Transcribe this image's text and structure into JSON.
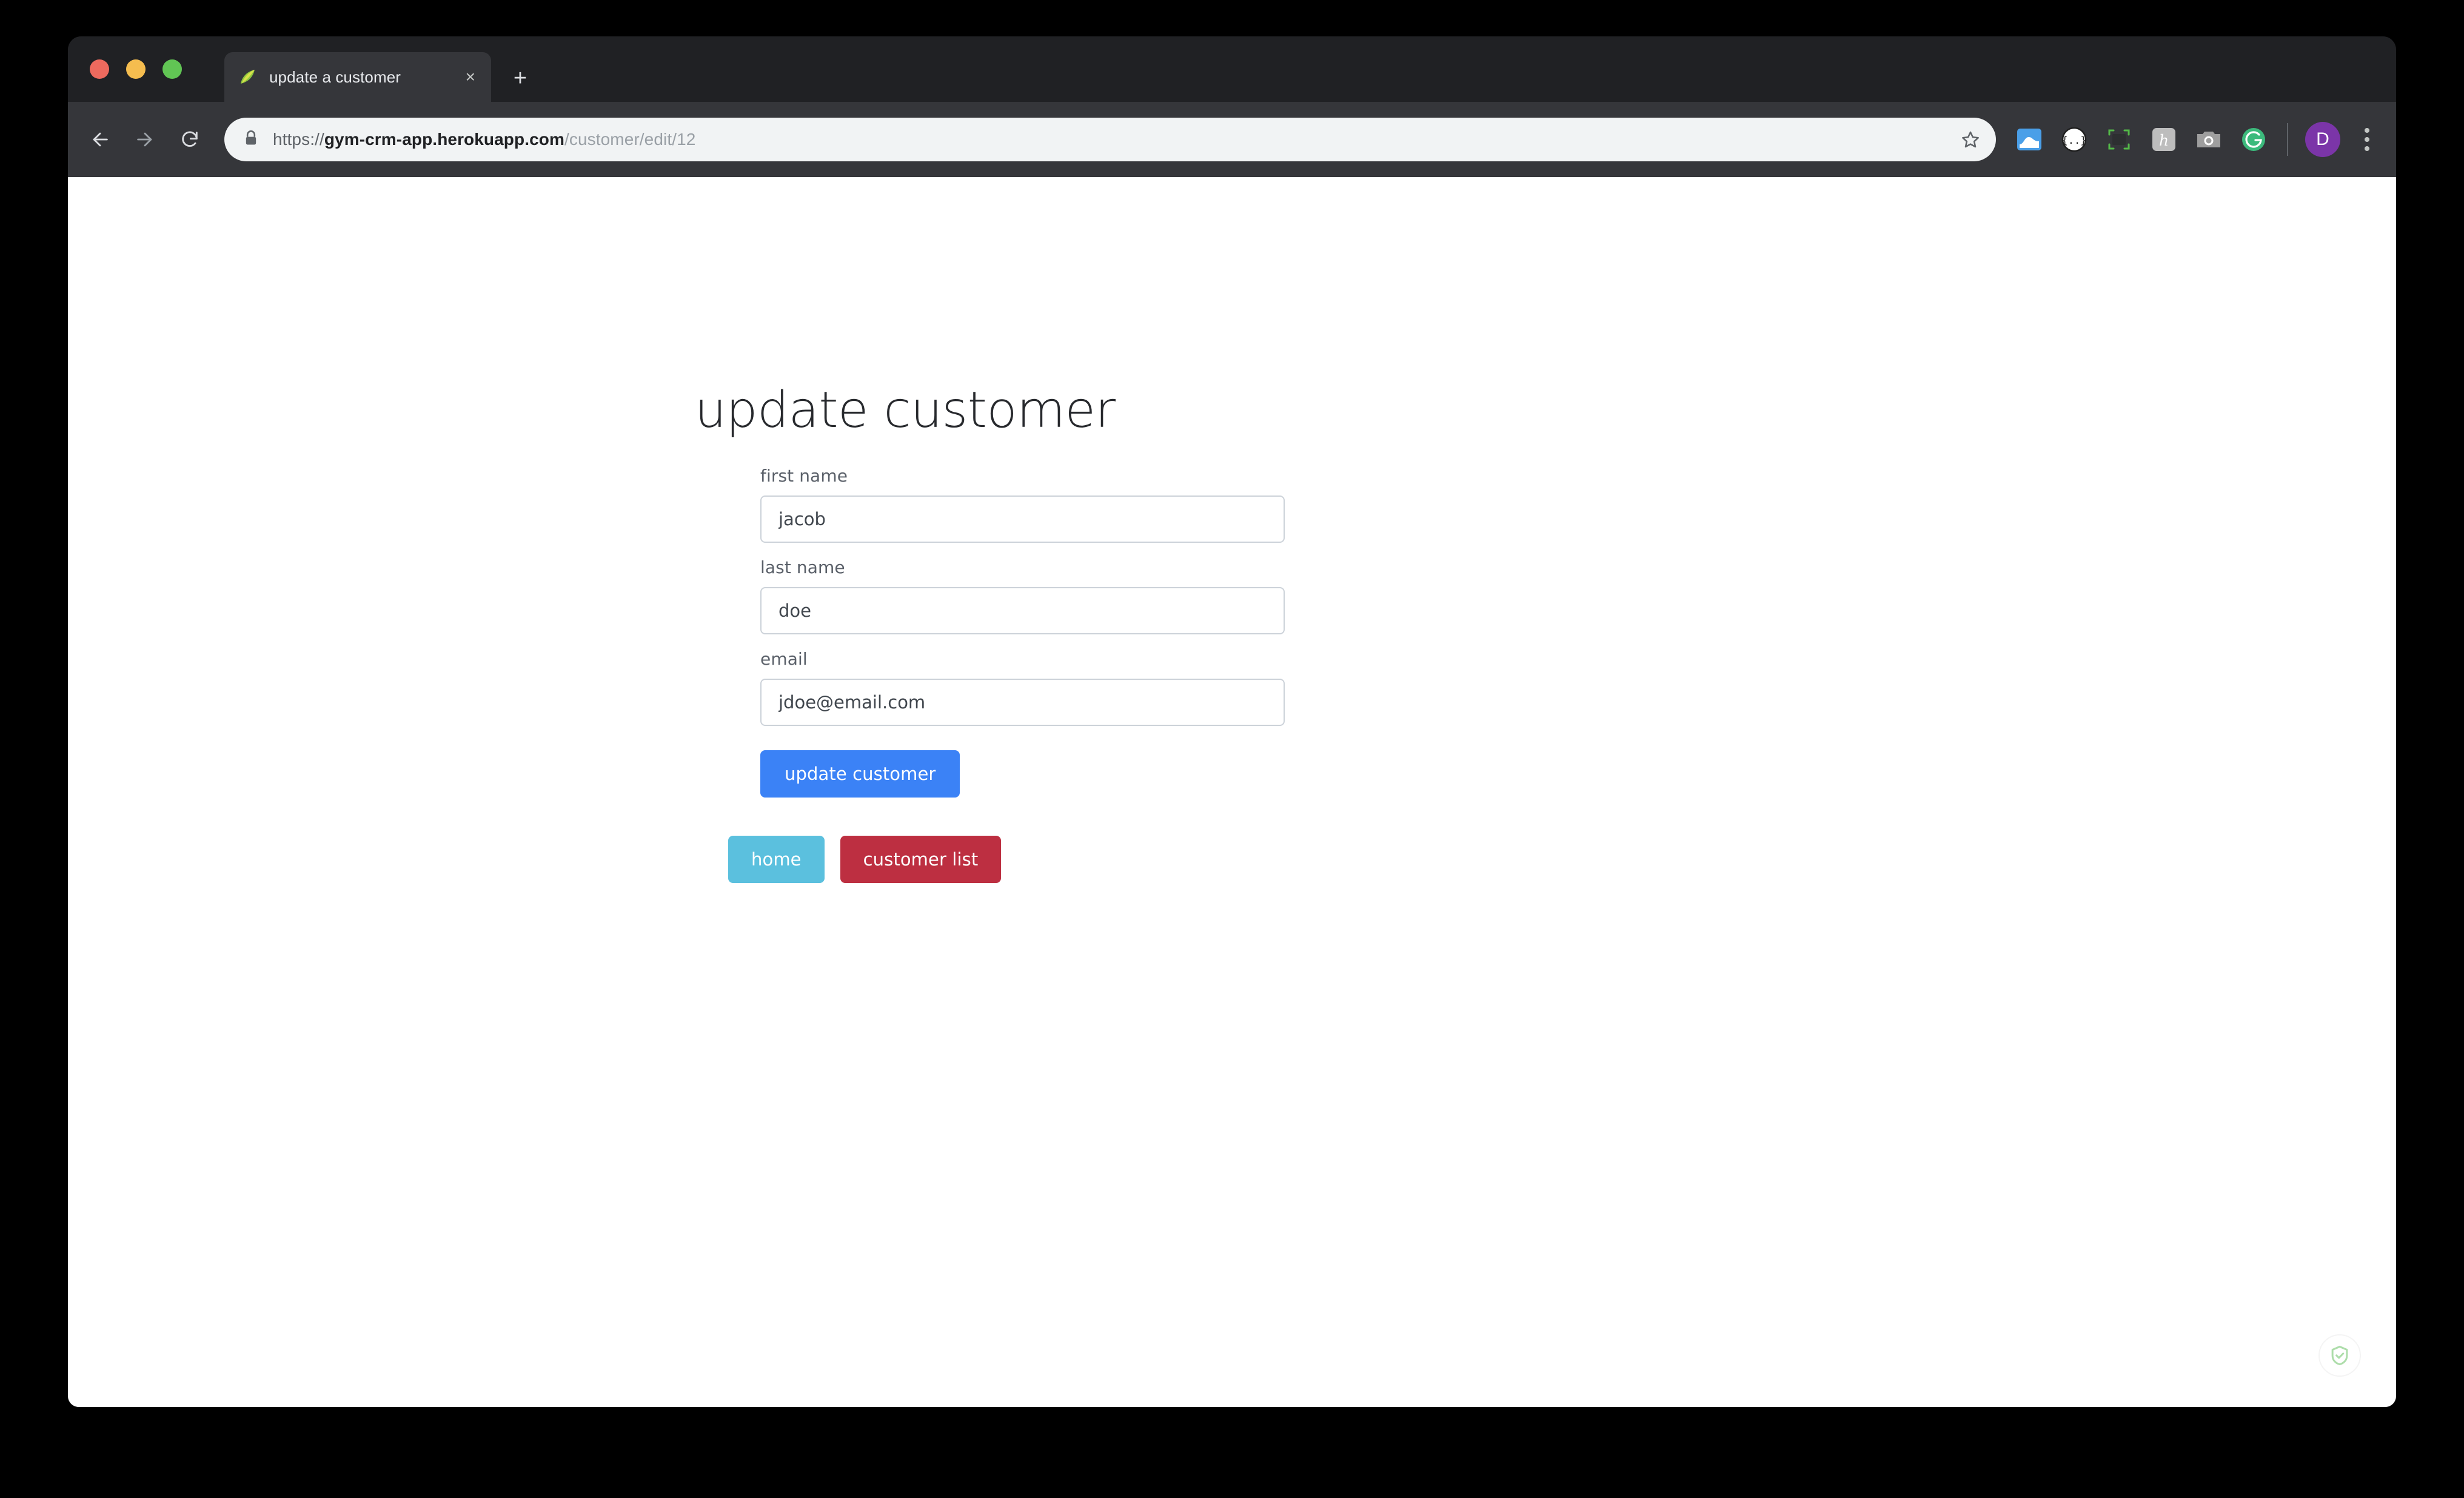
{
  "browser": {
    "tab": {
      "title": "update a customer",
      "favicon": "spring-leaf-icon",
      "close_label": "×"
    },
    "new_tab_label": "+",
    "toolbar": {
      "back_icon": "back-arrow-icon",
      "forward_icon": "forward-arrow-icon",
      "reload_icon": "reload-icon",
      "lock_icon": "lock-icon",
      "url_scheme": "https://",
      "url_domain": "gym-crm-app.herokuapp.com",
      "url_path": "/customer/edit/12",
      "url_full": "https://gym-crm-app.herokuapp.com/customer/edit/12",
      "bookmark_icon": "star-icon",
      "extensions": [
        {
          "name": "pocket-extension-icon",
          "label": ""
        },
        {
          "name": "json-viewer-extension-icon",
          "label": "{...}"
        },
        {
          "name": "screen-capture-extension-icon",
          "label": ""
        },
        {
          "name": "honey-extension-icon",
          "label": "h"
        },
        {
          "name": "camera-extension-icon",
          "label": ""
        },
        {
          "name": "grammarly-extension-icon",
          "label": "G"
        }
      ],
      "profile_initial": "D",
      "menu_icon": "three-dot-menu-icon"
    }
  },
  "page": {
    "heading": "update customer",
    "form": {
      "fields": [
        {
          "label": "first name",
          "value": "jacob",
          "name": "first-name"
        },
        {
          "label": "last name",
          "value": "doe",
          "name": "last-name"
        },
        {
          "label": "email",
          "value": "jdoe@email.com",
          "name": "email"
        }
      ],
      "submit_label": "update customer"
    },
    "nav_buttons": [
      {
        "label": "home",
        "color": "#5bc0de"
      },
      {
        "label": "customer list",
        "color": "#bd2f41"
      }
    ],
    "adblock_badge_icon": "shield-check-icon"
  },
  "colors": {
    "accent_blue": "#3b82f6",
    "info_cyan": "#5bc0de",
    "danger_red": "#bd2f41",
    "chrome_dark": "#202124",
    "toolbar_dark": "#35363a",
    "input_border": "#ccd2d9",
    "label_grey": "#5a6069",
    "profile_purple": "#7b35a8"
  }
}
